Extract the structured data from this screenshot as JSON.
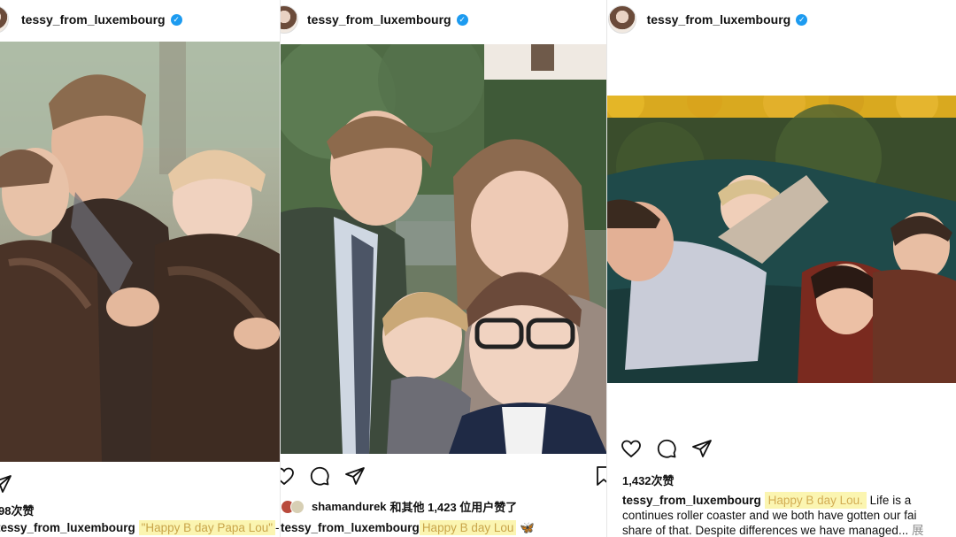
{
  "accent": {
    "verified": "#1d9bf0",
    "highlight": "#fbf5b1",
    "highlight_text": "#c9a54a"
  },
  "posts": [
    {
      "username": "tessy_from_luxembourg",
      "likes": "98次赞",
      "caption_user": "tessy_from_luxembourg",
      "caption_highlight": "\"Happy B day Papa Lou\"",
      "caption_tail": "-",
      "icons": [
        "share-icon"
      ]
    },
    {
      "username": "tessy_from_luxembourg",
      "liked_by_user": "shamandurek",
      "liked_by_rest": "和其他 1,423 位用户赞了",
      "caption_user": "tessy_from_luxembourg",
      "caption_highlight": "Happy B day Lou",
      "caption_emoji": "🦋",
      "icons": [
        "heart-icon",
        "comment-icon",
        "share-icon",
        "bookmark-icon"
      ]
    },
    {
      "username": "tessy_from_luxembourg",
      "likes": "1,432次赞",
      "caption_user": "tessy_from_luxembourg",
      "caption_highlight": "Happy B day Lou.",
      "caption_line1_tail": "Life is a",
      "caption_line2": "continues roller coaster and we both have gotten our fai",
      "caption_line3": "share of that. Despite differences we have managed...",
      "caption_more": "展",
      "icons": [
        "heart-icon",
        "comment-icon",
        "share-icon"
      ]
    }
  ]
}
